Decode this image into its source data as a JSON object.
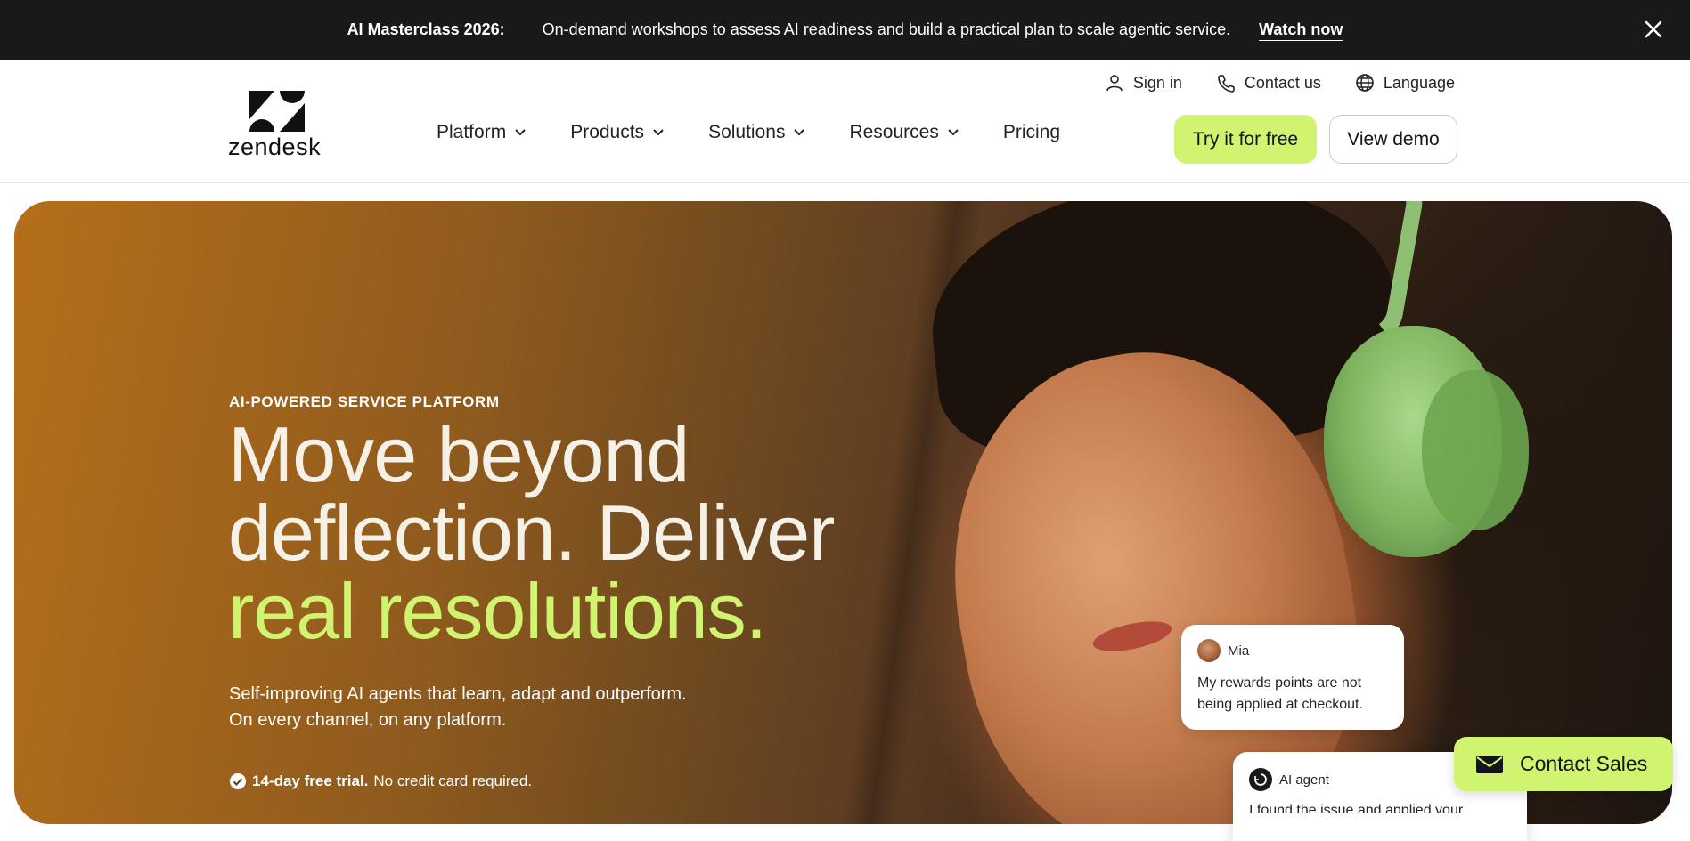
{
  "announcement": {
    "tag": "AI Masterclass 2026:",
    "message": "On-demand workshops to assess AI readiness and build a practical plan to scale agentic service.",
    "cta": "Watch now",
    "close_icon": "close-icon"
  },
  "utility_nav": [
    {
      "label": "Sign in",
      "icon": "user-icon"
    },
    {
      "label": "Contact us",
      "icon": "phone-icon"
    },
    {
      "label": "Language",
      "icon": "globe-icon"
    }
  ],
  "brand": {
    "name": "zendesk"
  },
  "main_nav": [
    {
      "label": "Platform",
      "has_dropdown": true
    },
    {
      "label": "Products",
      "has_dropdown": true
    },
    {
      "label": "Solutions",
      "has_dropdown": true
    },
    {
      "label": "Resources",
      "has_dropdown": true
    },
    {
      "label": "Pricing",
      "has_dropdown": false
    }
  ],
  "header_buttons": {
    "primary": "Try it for free",
    "secondary": "View demo"
  },
  "hero": {
    "eyebrow": "AI-POWERED SERVICE PLATFORM",
    "headline_line1": "Move beyond",
    "headline_line2": "deflection. Deliver",
    "headline_accent": "real resolutions.",
    "subhead_line1": "Self-improving AI agents that learn, adapt and outperform.",
    "subhead_line2": "On every channel, on any platform.",
    "trial_bold": "14-day free trial.",
    "trial_rest": "No credit card required."
  },
  "chat": {
    "customer": {
      "name": "Mia",
      "message": "My rewards points are not being applied at checkout."
    },
    "agent": {
      "name": "AI agent",
      "message": "I found the issue and applied your"
    }
  },
  "floating_cta": {
    "label": "Contact Sales",
    "icon": "mail-icon"
  },
  "colors": {
    "accent": "#d1f470",
    "announcement_bg": "#17191a",
    "text_dark": "#1f2228"
  }
}
